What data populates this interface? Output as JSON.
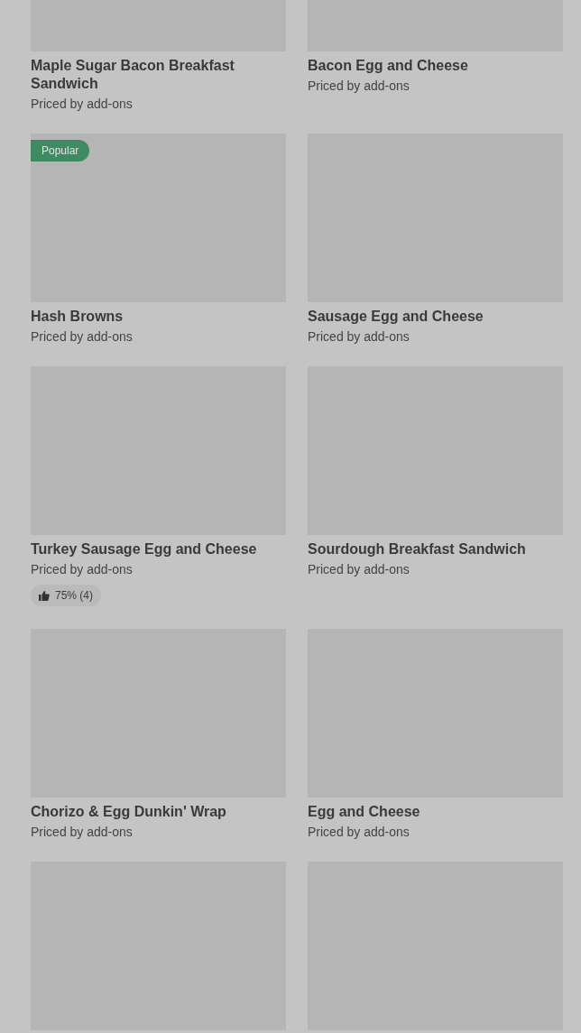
{
  "items": [
    {
      "kind": "item",
      "name": "Maple Sugar Bacon Breakfast Sandwich",
      "price_note": "Priced by add-ons"
    },
    {
      "kind": "item",
      "name": "Bacon Egg and Cheese",
      "price_note": "Priced by add-ons"
    },
    {
      "kind": "item",
      "name": "Hash Browns",
      "price_note": "Priced by add-ons",
      "badge": "Popular"
    },
    {
      "kind": "item",
      "name": "Sausage Egg and Cheese",
      "price_note": "Priced by add-ons"
    },
    {
      "kind": "item",
      "name": "Turkey Sausage Egg and Cheese",
      "price_note": "Priced by add-ons",
      "rating": "75% (4)"
    },
    {
      "kind": "item",
      "name": "Sourdough Breakfast Sandwich",
      "price_note": "Priced by add-ons"
    },
    {
      "kind": "item",
      "name": "Chorizo & Egg Dunkin' Wrap",
      "price_note": "Priced by add-ons"
    },
    {
      "kind": "item",
      "name": "Egg and Cheese",
      "price_note": "Priced by add-ons"
    },
    {
      "kind": "cut"
    },
    {
      "kind": "cut"
    }
  ]
}
